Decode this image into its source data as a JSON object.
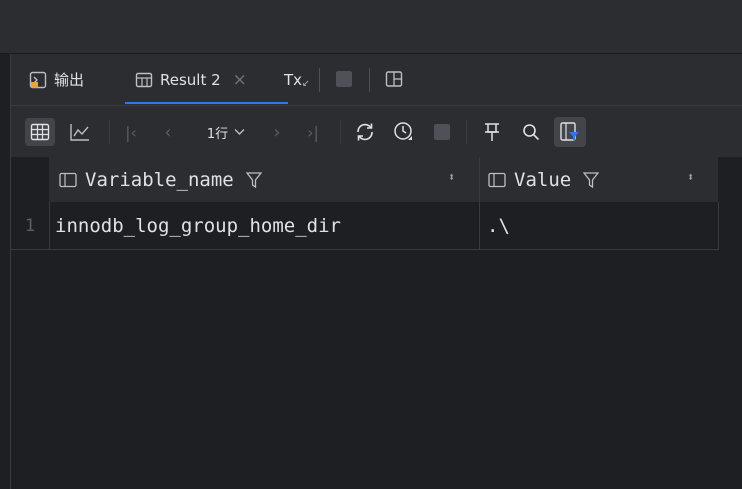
{
  "tabs": {
    "output_label": "输出",
    "result_label": "Result 2",
    "close_glyph": "×",
    "tx_label": "Tx"
  },
  "toolbar": {
    "rows_label": "1行"
  },
  "table": {
    "columns": [
      {
        "label": "Variable_name"
      },
      {
        "label": "Value"
      }
    ],
    "rows": [
      {
        "num": "1",
        "cells": [
          "innodb_log_group_home_dir",
          ".\\"
        ]
      }
    ]
  },
  "colors": {
    "accent": "#3574f0",
    "panel": "#2b2d30",
    "background": "#1e1f22"
  }
}
